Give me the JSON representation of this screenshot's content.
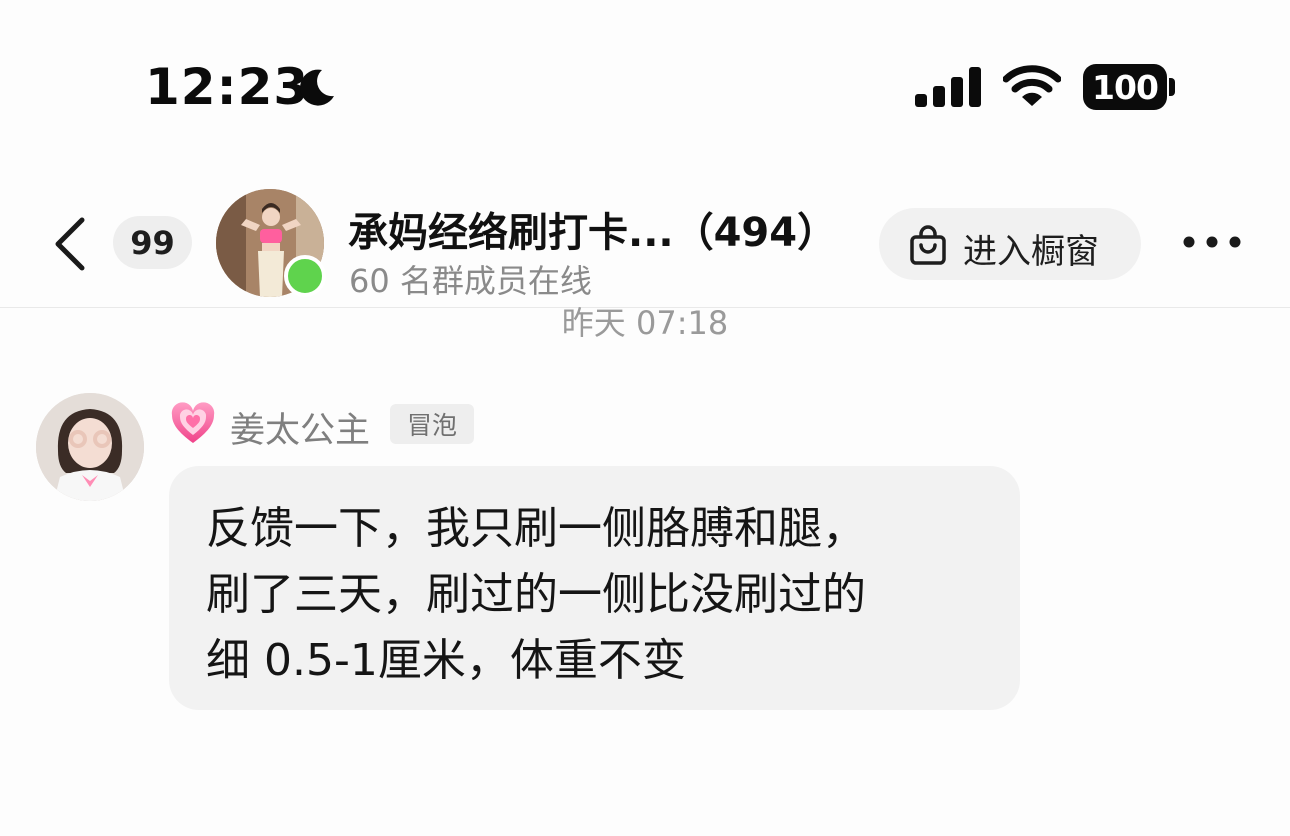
{
  "status_bar": {
    "time": "12:23",
    "focus_icon": "moon-icon",
    "signal_icon": "cellular-signal-icon",
    "wifi_icon": "wifi-icon",
    "battery_level": "100"
  },
  "header": {
    "back_icon": "chevron-left-icon",
    "unread_count": "99",
    "title": "承妈经络刷打卡...（494）",
    "subtitle": "60 名群成员在线",
    "online_status_color": "#5fd34d",
    "shop_button": {
      "icon": "shopping-bag-icon",
      "label": "进入橱窗"
    },
    "more_icon": "more-horizontal-icon"
  },
  "messages": [
    {
      "timestamp": "昨天 07:18",
      "sender": {
        "badge_icon": "pink-heart-icon",
        "name": "姜太公主",
        "level_tag": "冒泡"
      },
      "lines": [
        "反馈一下，我只刷一侧胳膊和腿，",
        "刷了三天，刷过的一侧比没刷过的",
        "细 0.5-1厘米，体重不变"
      ]
    }
  ],
  "colors": {
    "bubble": "#f2f2f2",
    "badge_background": "#eeeeee",
    "heart": "#ff6fa8"
  }
}
